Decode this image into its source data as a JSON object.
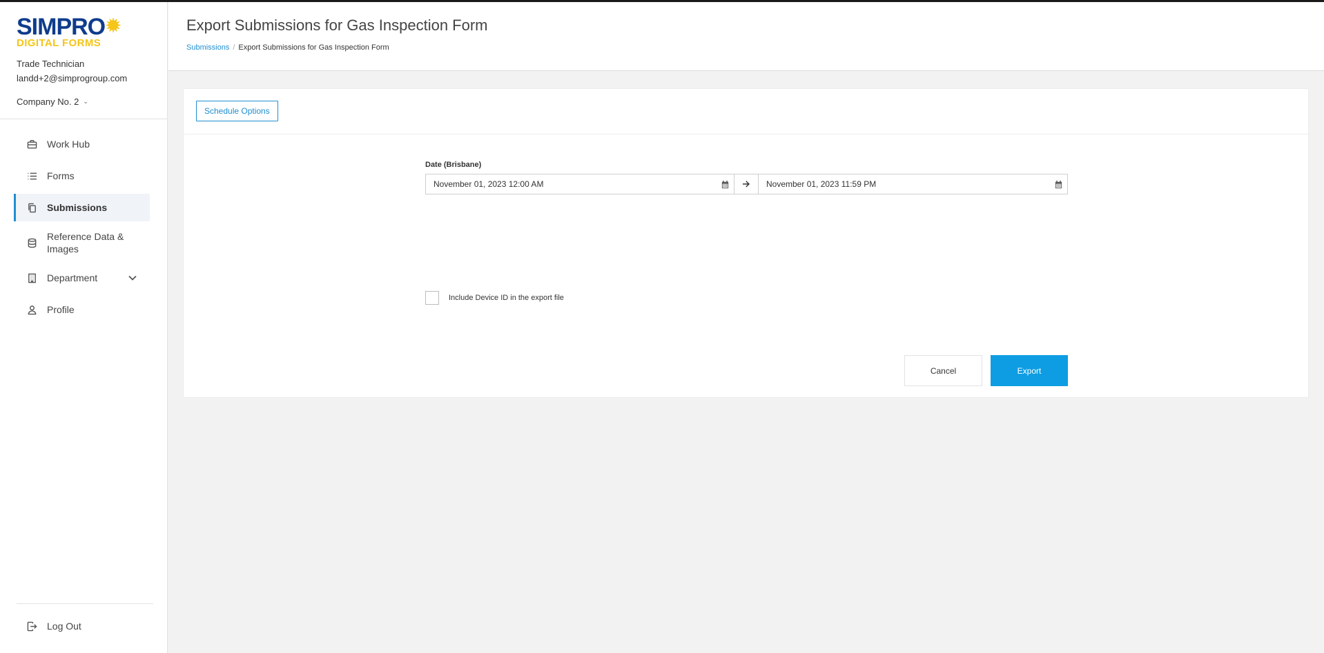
{
  "brand": {
    "name": "SIMPRO",
    "subtitle": "DIGITAL FORMS",
    "primary_color": "#0f3c8c",
    "accent_color": "#f5c518"
  },
  "user": {
    "role": "Trade Technician",
    "email": "landd+2@simprogroup.com",
    "company": "Company No. 2"
  },
  "sidebar": {
    "items": [
      {
        "label": "Work Hub",
        "icon": "briefcase-icon",
        "active": false
      },
      {
        "label": "Forms",
        "icon": "list-icon",
        "active": false
      },
      {
        "label": "Submissions",
        "icon": "copy-icon",
        "active": true
      },
      {
        "label": "Reference Data & Images",
        "icon": "database-icon",
        "active": false
      },
      {
        "label": "Department",
        "icon": "building-icon",
        "active": false,
        "expandable": true
      },
      {
        "label": "Profile",
        "icon": "user-icon",
        "active": false
      }
    ],
    "logout_label": "Log Out",
    "active_indicator_color": "#1f8ed1"
  },
  "header": {
    "title": "Export Submissions for Gas Inspection Form",
    "breadcrumb": {
      "parent": "Submissions",
      "separator": "/",
      "current": "Export Submissions for Gas Inspection Form"
    }
  },
  "toolbar": {
    "schedule_label": "Schedule Options"
  },
  "form": {
    "date_label": "Date (Brisbane)",
    "date_from": "November 01, 2023 12:00 AM",
    "date_to": "November 01, 2023 11:59 PM",
    "include_device_label": "Include Device ID in the export file",
    "include_device_checked": false,
    "cancel_label": "Cancel",
    "export_label": "Export",
    "export_color": "#0e9de3"
  }
}
